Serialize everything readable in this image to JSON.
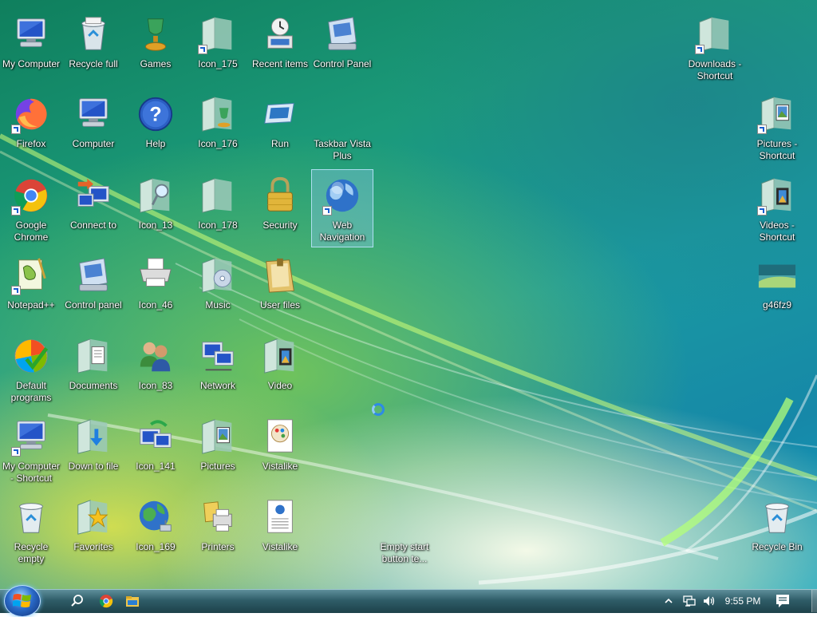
{
  "desktop": {
    "icons": [
      {
        "label": "My Computer",
        "icon": "computer-icon"
      },
      {
        "label": "Recycle full",
        "icon": "recycle-full-icon"
      },
      {
        "label": "Games",
        "icon": "games-icon"
      },
      {
        "label": "Icon_175",
        "icon": "folder-icon"
      },
      {
        "label": "Recent items",
        "icon": "recent-items-icon"
      },
      {
        "label": "Control Panel",
        "icon": "control-panel-icon"
      },
      {
        "label": "Downloads - Shortcut",
        "icon": "folder-icon"
      },
      {
        "label": "Firefox",
        "icon": "firefox-icon"
      },
      {
        "label": "Computer",
        "icon": "computer-icon"
      },
      {
        "label": "Help",
        "icon": "help-icon"
      },
      {
        "label": "Icon_176",
        "icon": "games-folder-icon"
      },
      {
        "label": "Run",
        "icon": "run-icon"
      },
      {
        "label": "Taskbar Vista Plus",
        "icon": "blank-icon"
      },
      {
        "label": "Pictures - Shortcut",
        "icon": "pictures-folder-icon"
      },
      {
        "label": "Google Chrome",
        "icon": "chrome-icon"
      },
      {
        "label": "Connect to",
        "icon": "connect-icon"
      },
      {
        "label": "Icon_13",
        "icon": "search-folder-icon"
      },
      {
        "label": "Icon_178",
        "icon": "folder-icon"
      },
      {
        "label": "Security",
        "icon": "lock-icon"
      },
      {
        "label": "Web Navigation",
        "icon": "globe-icon"
      },
      {
        "label": "Videos - Shortcut",
        "icon": "video-folder-icon"
      },
      {
        "label": "Notepad++",
        "icon": "notepad-icon"
      },
      {
        "label": "Control panel",
        "icon": "control-panel-icon"
      },
      {
        "label": "Icon_46",
        "icon": "printer-icon"
      },
      {
        "label": "Music",
        "icon": "music-folder-icon"
      },
      {
        "label": "User files",
        "icon": "user-folder-icon"
      },
      {
        "label": "g46fz9",
        "icon": "image-thumbnail-icon"
      },
      {
        "label": "Default programs",
        "icon": "default-programs-icon"
      },
      {
        "label": "Documents",
        "icon": "documents-folder-icon"
      },
      {
        "label": "Icon_83",
        "icon": "users-icon"
      },
      {
        "label": "Network",
        "icon": "network-icon"
      },
      {
        "label": "Video",
        "icon": "video-folder-icon"
      },
      {
        "label": "My Computer - Shortcut",
        "icon": "computer-icon"
      },
      {
        "label": "Down to file",
        "icon": "download-folder-icon"
      },
      {
        "label": "Icon_141",
        "icon": "network-sync-icon"
      },
      {
        "label": "Pictures",
        "icon": "pictures-folder-icon"
      },
      {
        "label": "Vistalike",
        "icon": "paint-file-icon"
      },
      {
        "label": "Recycle empty",
        "icon": "recycle-empty-icon"
      },
      {
        "label": "Favorites",
        "icon": "favorites-folder-icon"
      },
      {
        "label": "Icon_169",
        "icon": "globe-network-icon"
      },
      {
        "label": "Printers",
        "icon": "printers-icon"
      },
      {
        "label": "Vistalike",
        "icon": "web-document-icon"
      },
      {
        "label": "Empty start button te...",
        "icon": "blank-icon"
      },
      {
        "label": "Recycle Bin",
        "icon": "recycle-empty-icon"
      }
    ]
  },
  "taskbar": {
    "start_icon": "windows-logo-icon",
    "pinned": [
      {
        "name": "search",
        "icon": "search-icon"
      },
      {
        "name": "chrome",
        "icon": "chrome-icon"
      },
      {
        "name": "file-explorer",
        "icon": "folder-icon"
      }
    ],
    "tray": {
      "chevron_icon": "chevron-up-icon",
      "network_icon": "network-icon",
      "volume_icon": "volume-icon",
      "time": "9:55 PM",
      "notification_icon": "notification-icon"
    }
  }
}
